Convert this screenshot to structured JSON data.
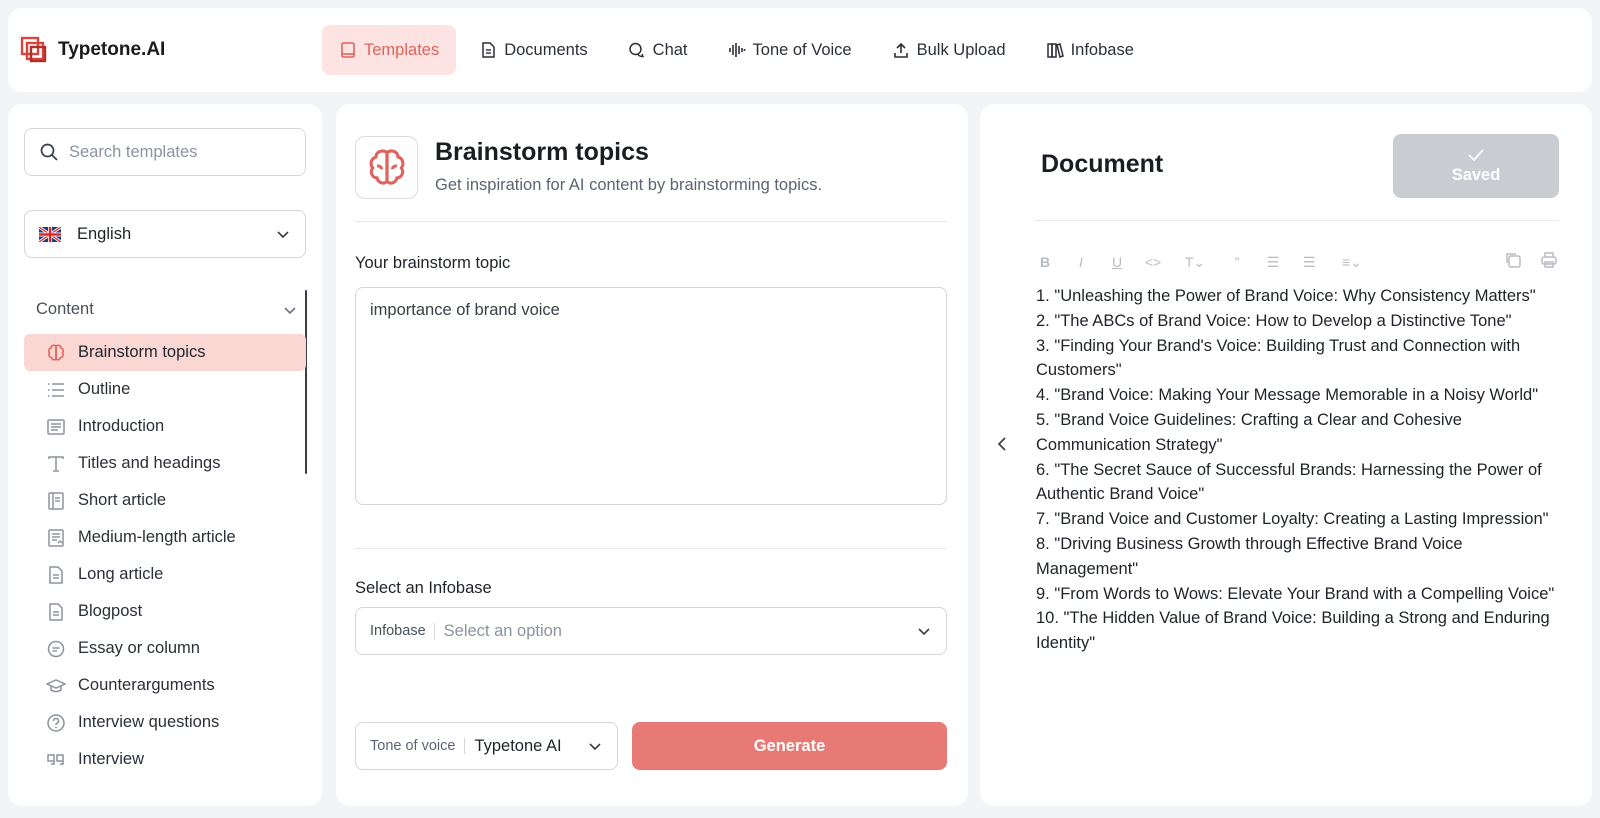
{
  "app": {
    "name": "Typetone.AI",
    "brand_color": "#e0625c"
  },
  "nav": [
    {
      "label": "Templates",
      "icon": "template-icon",
      "active": true
    },
    {
      "label": "Documents",
      "icon": "document-icon"
    },
    {
      "label": "Chat",
      "icon": "chat-icon"
    },
    {
      "label": "Tone of Voice",
      "icon": "waveform-icon"
    },
    {
      "label": "Bulk Upload",
      "icon": "upload-icon"
    },
    {
      "label": "Infobase",
      "icon": "books-icon"
    }
  ],
  "sidebar": {
    "search_placeholder": "Search templates",
    "language": "English",
    "section": "Content",
    "items": [
      {
        "label": "Brainstorm topics",
        "icon": "brain-icon",
        "active": true
      },
      {
        "label": "Outline",
        "icon": "list-icon"
      },
      {
        "label": "Introduction",
        "icon": "paragraph-icon"
      },
      {
        "label": "Titles and headings",
        "icon": "text-icon"
      },
      {
        "label": "Short article",
        "icon": "article-icon"
      },
      {
        "label": "Medium-length article",
        "icon": "article-icon"
      },
      {
        "label": "Long article",
        "icon": "file-icon"
      },
      {
        "label": "Blogpost",
        "icon": "file-icon"
      },
      {
        "label": "Essay or column",
        "icon": "comment-icon"
      },
      {
        "label": "Counterarguments",
        "icon": "graduation-icon"
      },
      {
        "label": "Interview questions",
        "icon": "question-icon"
      },
      {
        "label": "Interview",
        "icon": "quote-icon"
      }
    ]
  },
  "template": {
    "title": "Brainstorm topics",
    "subtitle": "Get inspiration for AI content by brainstorming topics.",
    "topic_label": "Your brainstorm topic",
    "topic_value": "importance of brand voice",
    "infobase_label": "Select an Infobase",
    "infobase_prefix": "Infobase",
    "infobase_placeholder": "Select an option",
    "tone_prefix": "Tone of voice",
    "tone_value": "Typetone AI",
    "generate_label": "Generate"
  },
  "document": {
    "title": "Document",
    "saved_label": "Saved",
    "lines": [
      "1. \"Unleashing the Power of Brand Voice: Why Consistency Matters\"",
      "2. \"The ABCs of Brand Voice: How to Develop a Distinctive Tone\"",
      "3. \"Finding Your Brand's Voice: Building Trust and Connection with Customers\"",
      "4. \"Brand Voice: Making Your Message Memorable in a Noisy World\"",
      "5. \"Brand Voice Guidelines: Crafting a Clear and Cohesive Communication Strategy\"",
      "6. \"The Secret Sauce of Successful Brands: Harnessing the Power of Authentic Brand Voice\"",
      "7. \"Brand Voice and Customer Loyalty: Creating a Lasting Impression\"",
      "8. \"Driving Business Growth through Effective Brand Voice Management\"",
      "9. \"From Words to Wows: Elevate Your Brand with a Compelling Voice\"",
      "10. \"The Hidden Value of Brand Voice: Building a Strong and Enduring Identity\""
    ]
  }
}
